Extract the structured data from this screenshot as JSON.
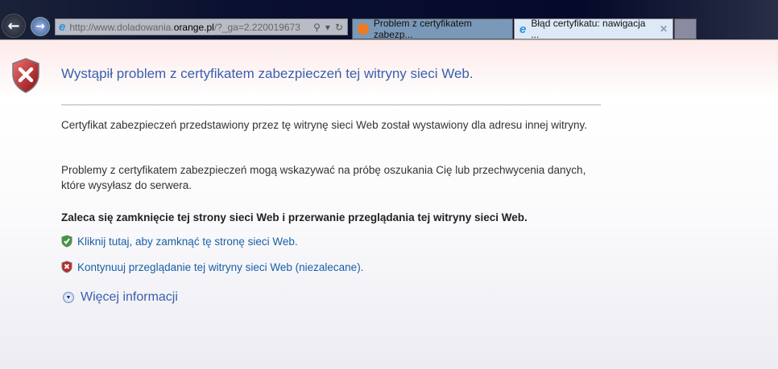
{
  "browser": {
    "address": {
      "prefix": "http://www.doladowania.",
      "domain": "orange.pl",
      "suffix": "/?_ga=2.220019673"
    },
    "tabs": [
      {
        "label": "Problem z certyfikatem zabezp...",
        "active": false
      },
      {
        "label": "Błąd certyfikatu: nawigacja ...",
        "active": true
      }
    ]
  },
  "page": {
    "title": "Wystąpił problem z certyfikatem zabezpieczeń tej witryny sieci Web.",
    "para1": "Certyfikat zabezpieczeń przedstawiony przez tę witrynę sieci Web został wystawiony dla adresu innej witryny.",
    "para2": "Problemy z certyfikatem zabezpieczeń mogą wskazywać na próbę oszukania Cię lub przechwycenia danych, które wysyłasz do serwera.",
    "recommendation": "Zaleca się zamknięcie tej strony sieci Web i przerwanie przeglądania tej witryny sieci Web.",
    "close_link": "Kliknij tutaj, aby zamknąć tę stronę sieci Web.",
    "continue_link": "Kontynuuj przeglądanie tej witryny sieci Web (niezalecane).",
    "more_info": "Więcej informacji"
  },
  "colors": {
    "title": "#3a5fae",
    "link": "#1a5ea8",
    "error_shield": "#c0282a",
    "ok_shield": "#3a9a3a"
  }
}
